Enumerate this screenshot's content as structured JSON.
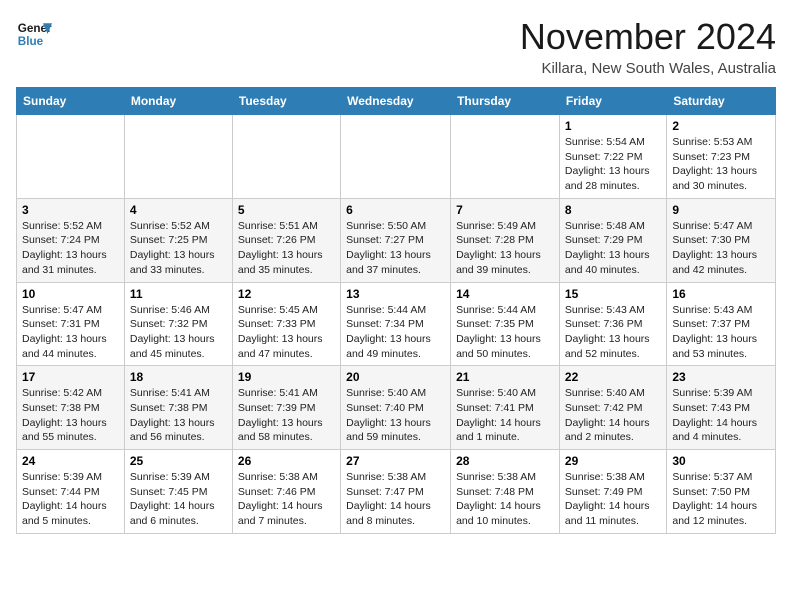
{
  "logo": {
    "line1": "General",
    "line2": "Blue"
  },
  "title": "November 2024",
  "location": "Killara, New South Wales, Australia",
  "weekdays": [
    "Sunday",
    "Monday",
    "Tuesday",
    "Wednesday",
    "Thursday",
    "Friday",
    "Saturday"
  ],
  "weeks": [
    [
      {
        "day": "",
        "info": ""
      },
      {
        "day": "",
        "info": ""
      },
      {
        "day": "",
        "info": ""
      },
      {
        "day": "",
        "info": ""
      },
      {
        "day": "",
        "info": ""
      },
      {
        "day": "1",
        "info": "Sunrise: 5:54 AM\nSunset: 7:22 PM\nDaylight: 13 hours and 28 minutes."
      },
      {
        "day": "2",
        "info": "Sunrise: 5:53 AM\nSunset: 7:23 PM\nDaylight: 13 hours and 30 minutes."
      }
    ],
    [
      {
        "day": "3",
        "info": "Sunrise: 5:52 AM\nSunset: 7:24 PM\nDaylight: 13 hours and 31 minutes."
      },
      {
        "day": "4",
        "info": "Sunrise: 5:52 AM\nSunset: 7:25 PM\nDaylight: 13 hours and 33 minutes."
      },
      {
        "day": "5",
        "info": "Sunrise: 5:51 AM\nSunset: 7:26 PM\nDaylight: 13 hours and 35 minutes."
      },
      {
        "day": "6",
        "info": "Sunrise: 5:50 AM\nSunset: 7:27 PM\nDaylight: 13 hours and 37 minutes."
      },
      {
        "day": "7",
        "info": "Sunrise: 5:49 AM\nSunset: 7:28 PM\nDaylight: 13 hours and 39 minutes."
      },
      {
        "day": "8",
        "info": "Sunrise: 5:48 AM\nSunset: 7:29 PM\nDaylight: 13 hours and 40 minutes."
      },
      {
        "day": "9",
        "info": "Sunrise: 5:47 AM\nSunset: 7:30 PM\nDaylight: 13 hours and 42 minutes."
      }
    ],
    [
      {
        "day": "10",
        "info": "Sunrise: 5:47 AM\nSunset: 7:31 PM\nDaylight: 13 hours and 44 minutes."
      },
      {
        "day": "11",
        "info": "Sunrise: 5:46 AM\nSunset: 7:32 PM\nDaylight: 13 hours and 45 minutes."
      },
      {
        "day": "12",
        "info": "Sunrise: 5:45 AM\nSunset: 7:33 PM\nDaylight: 13 hours and 47 minutes."
      },
      {
        "day": "13",
        "info": "Sunrise: 5:44 AM\nSunset: 7:34 PM\nDaylight: 13 hours and 49 minutes."
      },
      {
        "day": "14",
        "info": "Sunrise: 5:44 AM\nSunset: 7:35 PM\nDaylight: 13 hours and 50 minutes."
      },
      {
        "day": "15",
        "info": "Sunrise: 5:43 AM\nSunset: 7:36 PM\nDaylight: 13 hours and 52 minutes."
      },
      {
        "day": "16",
        "info": "Sunrise: 5:43 AM\nSunset: 7:37 PM\nDaylight: 13 hours and 53 minutes."
      }
    ],
    [
      {
        "day": "17",
        "info": "Sunrise: 5:42 AM\nSunset: 7:38 PM\nDaylight: 13 hours and 55 minutes."
      },
      {
        "day": "18",
        "info": "Sunrise: 5:41 AM\nSunset: 7:38 PM\nDaylight: 13 hours and 56 minutes."
      },
      {
        "day": "19",
        "info": "Sunrise: 5:41 AM\nSunset: 7:39 PM\nDaylight: 13 hours and 58 minutes."
      },
      {
        "day": "20",
        "info": "Sunrise: 5:40 AM\nSunset: 7:40 PM\nDaylight: 13 hours and 59 minutes."
      },
      {
        "day": "21",
        "info": "Sunrise: 5:40 AM\nSunset: 7:41 PM\nDaylight: 14 hours and 1 minute."
      },
      {
        "day": "22",
        "info": "Sunrise: 5:40 AM\nSunset: 7:42 PM\nDaylight: 14 hours and 2 minutes."
      },
      {
        "day": "23",
        "info": "Sunrise: 5:39 AM\nSunset: 7:43 PM\nDaylight: 14 hours and 4 minutes."
      }
    ],
    [
      {
        "day": "24",
        "info": "Sunrise: 5:39 AM\nSunset: 7:44 PM\nDaylight: 14 hours and 5 minutes."
      },
      {
        "day": "25",
        "info": "Sunrise: 5:39 AM\nSunset: 7:45 PM\nDaylight: 14 hours and 6 minutes."
      },
      {
        "day": "26",
        "info": "Sunrise: 5:38 AM\nSunset: 7:46 PM\nDaylight: 14 hours and 7 minutes."
      },
      {
        "day": "27",
        "info": "Sunrise: 5:38 AM\nSunset: 7:47 PM\nDaylight: 14 hours and 8 minutes."
      },
      {
        "day": "28",
        "info": "Sunrise: 5:38 AM\nSunset: 7:48 PM\nDaylight: 14 hours and 10 minutes."
      },
      {
        "day": "29",
        "info": "Sunrise: 5:38 AM\nSunset: 7:49 PM\nDaylight: 14 hours and 11 minutes."
      },
      {
        "day": "30",
        "info": "Sunrise: 5:37 AM\nSunset: 7:50 PM\nDaylight: 14 hours and 12 minutes."
      }
    ]
  ]
}
